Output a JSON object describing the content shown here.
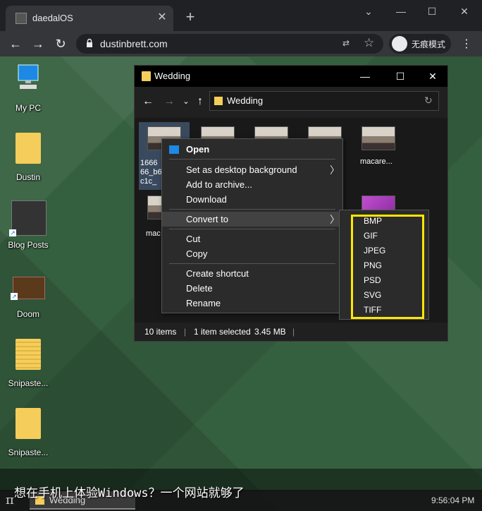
{
  "browser": {
    "tab_title": "daedalOS",
    "url": "dustinbrett.com",
    "incognito_label": "无痕模式",
    "colors": {
      "frame": "#202124",
      "toolbar": "#35363a"
    }
  },
  "desktop": {
    "icons": [
      {
        "label": "My PC",
        "icon": "computer-icon"
      },
      {
        "label": "Dustin",
        "icon": "folder-icon"
      },
      {
        "label": "Blog Posts",
        "icon": "blog-shortcut-icon"
      },
      {
        "label": "Doom",
        "icon": "doom-shortcut-icon"
      },
      {
        "label": "Snipaste...",
        "icon": "zip-folder-icon"
      },
      {
        "label": "Snipaste...",
        "icon": "folder-icon"
      }
    ]
  },
  "explorer": {
    "title": "Wedding",
    "address": "Wedding",
    "selected_file_label": "1666 66_b6 c1c_",
    "file_macare": "macare...",
    "file_mac2": "mac",
    "status": {
      "items": "10 items",
      "selected": "1 item selected",
      "size": "3.45 MB",
      "sep": "|"
    }
  },
  "context_menu": {
    "open": "Open",
    "set_background": "Set as desktop background",
    "add_archive": "Add to archive...",
    "download": "Download",
    "convert_to": "Convert to",
    "cut": "Cut",
    "copy": "Copy",
    "create_shortcut": "Create shortcut",
    "delete": "Delete",
    "rename": "Rename",
    "arrow": "〉"
  },
  "submenu": [
    "BMP",
    "GIF",
    "JPEG",
    "PNG",
    "PSD",
    "SVG",
    "TIFF"
  ],
  "taskbar": {
    "task_label": "Wedding",
    "clock": "9:56:04 PM",
    "start_glyph": "π"
  },
  "caption": "想在手机上体验Windows？一个网站就够了",
  "highlight_color": "#ffe600"
}
